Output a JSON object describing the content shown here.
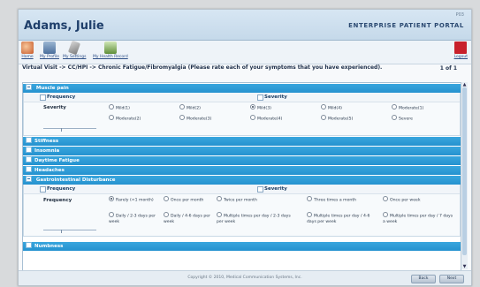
{
  "header": {
    "patient_name": "Adams, Julie",
    "portal_title": "ENTERPRISE PATIENT PORTAL",
    "page_id": "P03"
  },
  "toolbar": {
    "home": "Home",
    "profile": "My Profile",
    "settings": "My Settings",
    "record": "My Health Record",
    "logout": "Logout"
  },
  "breadcrumb": "Virtual Visit -> CC/HPI -> Chronic Fatigue/Fibromyalgia (Please rate each of your symptoms that you have experienced).",
  "page_count": "1 of 1",
  "sections": {
    "muscle_pain": {
      "title": "Muscle pain",
      "frequency_label": "Frequency",
      "severity_label": "Severity",
      "severity_row_label": "Severity",
      "options": [
        "Mild(1)",
        "Mild(2)",
        "Mild(3)",
        "Mild(4)",
        "Moderate(1)",
        "Moderate(2)",
        "Moderate(3)",
        "Moderate(4)",
        "Moderate(5)",
        "Severe"
      ],
      "selected": "Mild(3)"
    },
    "stiffness": "Stiffness",
    "insomnia": "Insomnia",
    "daytime_fatigue": "Daytime Fatigue",
    "headaches": "Headaches",
    "gi_disturbance": {
      "title": "Gastrointestinal Disturbance",
      "frequency_label": "Frequency",
      "severity_label": "Severity",
      "frequency_row_label": "Frequency",
      "options": [
        "Rarely (<1 month)",
        "Once per month",
        "Twice per month",
        "Three times a month",
        "Once per week",
        "Daily / 2-3 days per week",
        "Daily / 4-6 days per week",
        "Multiple times per day / 2-3 days per week",
        "Multiple times per day / 4-6 days per week",
        "Multiple times per day / 7 days a week"
      ],
      "selected": "Rarely (<1 month)"
    },
    "numbness": "Numbness"
  },
  "footer": {
    "copyright": "Copyright © 2010, Medical Communication Systems, Inc.",
    "btn_back": "Back",
    "btn_next": "Next"
  }
}
